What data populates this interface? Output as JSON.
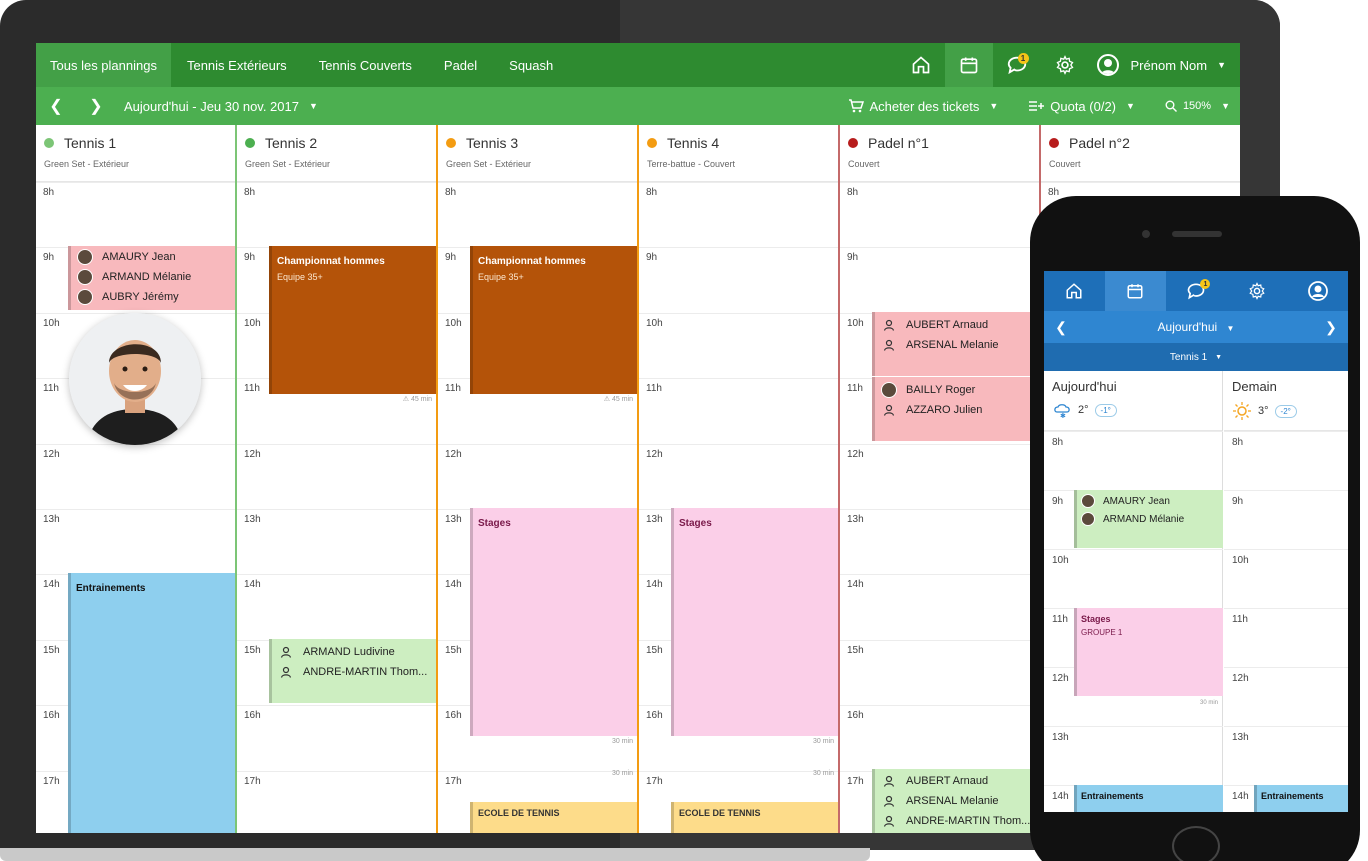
{
  "tabs": [
    "Tous les plannings",
    "Tennis Extérieurs",
    "Tennis Couverts",
    "Padel",
    "Squash"
  ],
  "user": {
    "name": "Prénom Nom"
  },
  "notification_count": "1",
  "subnav": {
    "date": "Aujourd'hui - Jeu 30 nov. 2017",
    "tickets": "Acheter des tickets",
    "quota": "Quota (0/2)",
    "zoom": "150%"
  },
  "colors": {
    "primary": "#2e8b30",
    "accent": "#4caf50",
    "mobile": "#1e6fb8"
  },
  "hours": [
    "8h",
    "9h",
    "10h",
    "11h",
    "12h",
    "13h",
    "14h",
    "15h",
    "16h",
    "17h"
  ],
  "courts": [
    {
      "name": "Tennis 1",
      "sub": "Green Set - Extérieur",
      "dot": "#7cc576"
    },
    {
      "name": "Tennis 2",
      "sub": "Green Set - Extérieur",
      "dot": "#4caf50"
    },
    {
      "name": "Tennis 3",
      "sub": "Green Set - Extérieur",
      "dot": "#f39c12"
    },
    {
      "name": "Tennis 4",
      "sub": "Terre-battue - Couvert",
      "dot": "#f39c12"
    },
    {
      "name": "Padel n°1",
      "sub": "Couvert",
      "dot": "#b71c1c"
    },
    {
      "name": "Padel n°2",
      "sub": "Couvert",
      "dot": "#b71c1c"
    }
  ],
  "events": {
    "t1_players": [
      "AMAURY Jean",
      "ARMAND Mélanie",
      "AUBRY Jérémy"
    ],
    "t1_training": "Entrainements",
    "championship": {
      "title": "Championnat hommes",
      "sub": "Equipe 35+",
      "duration": "45 min"
    },
    "t2_players": [
      "ARMAND Ludivine",
      "ANDRE-MARTIN Thom..."
    ],
    "stages": "Stages",
    "stages_duration": "30 min",
    "school": "ECOLE DE TENNIS",
    "p1_a": [
      "AUBERT Arnaud",
      "ARSENAL Melanie"
    ],
    "p1_b": [
      "BAILLY Roger",
      "AZZARO Julien"
    ],
    "p1_c": [
      "AUBERT Arnaud",
      "ARSENAL Melanie",
      "ANDRE-MARTIN Thom..."
    ]
  },
  "mobile": {
    "date": "Aujourd'hui",
    "court": "Tennis 1",
    "today": {
      "label": "Aujourd'hui",
      "temp": "2°",
      "delta": "-1°"
    },
    "tomorrow": {
      "label": "Demain",
      "temp": "3°",
      "delta": "-2°"
    },
    "hours": [
      "8h",
      "9h",
      "10h",
      "11h",
      "12h",
      "13h",
      "14h"
    ],
    "players": [
      "AMAURY Jean",
      "ARMAND Mélanie"
    ],
    "stages": {
      "title": "Stages",
      "sub": "GROUPE 1",
      "duration": "30 min"
    },
    "training": "Entrainements"
  }
}
